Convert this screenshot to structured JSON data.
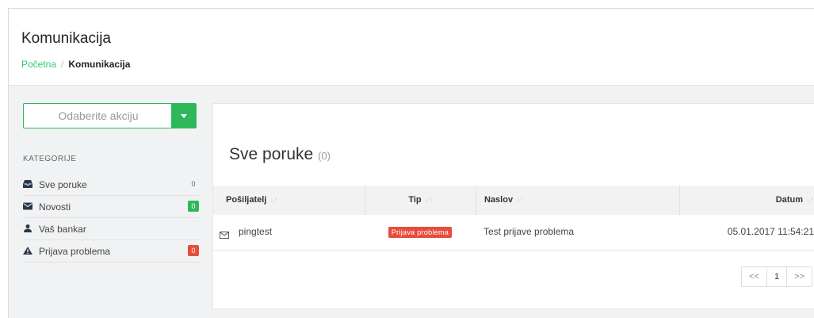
{
  "header": {
    "title": "Komunikacija",
    "breadcrumb": {
      "home": "Početna",
      "separator": "/",
      "current": "Komunikacija"
    }
  },
  "sidebar": {
    "action_select": {
      "label": "Odaberite akciju"
    },
    "categories_heading": "KATEGORIJE",
    "categories": [
      {
        "label": "Sve poruke",
        "count": "0",
        "icon": "inbox-icon",
        "badge_style": "plain"
      },
      {
        "label": "Novosti",
        "count": "0",
        "icon": "envelope-icon",
        "badge_style": "green"
      },
      {
        "label": "Vaš bankar",
        "count": "",
        "icon": "user-icon",
        "badge_style": "none"
      },
      {
        "label": "Prijava problema",
        "count": "0",
        "icon": "warning-icon",
        "badge_style": "red"
      }
    ]
  },
  "main": {
    "title": "Sve poruke",
    "count": "(0)",
    "table": {
      "columns": [
        "Pošiljatelj",
        "Tip",
        "Naslov",
        "Datum"
      ],
      "sort_glyph": "↓↑",
      "rows": [
        {
          "sender": "pingtest",
          "type": "Prijava problema",
          "subject": "Test prijave problema",
          "date": "05.01.2017 11:54:21"
        }
      ]
    },
    "pagination": {
      "prev": "<<",
      "page": "1",
      "next": ">>"
    }
  },
  "colors": {
    "accent_green": "#2eb85c",
    "danger_red": "#e74c3c"
  }
}
